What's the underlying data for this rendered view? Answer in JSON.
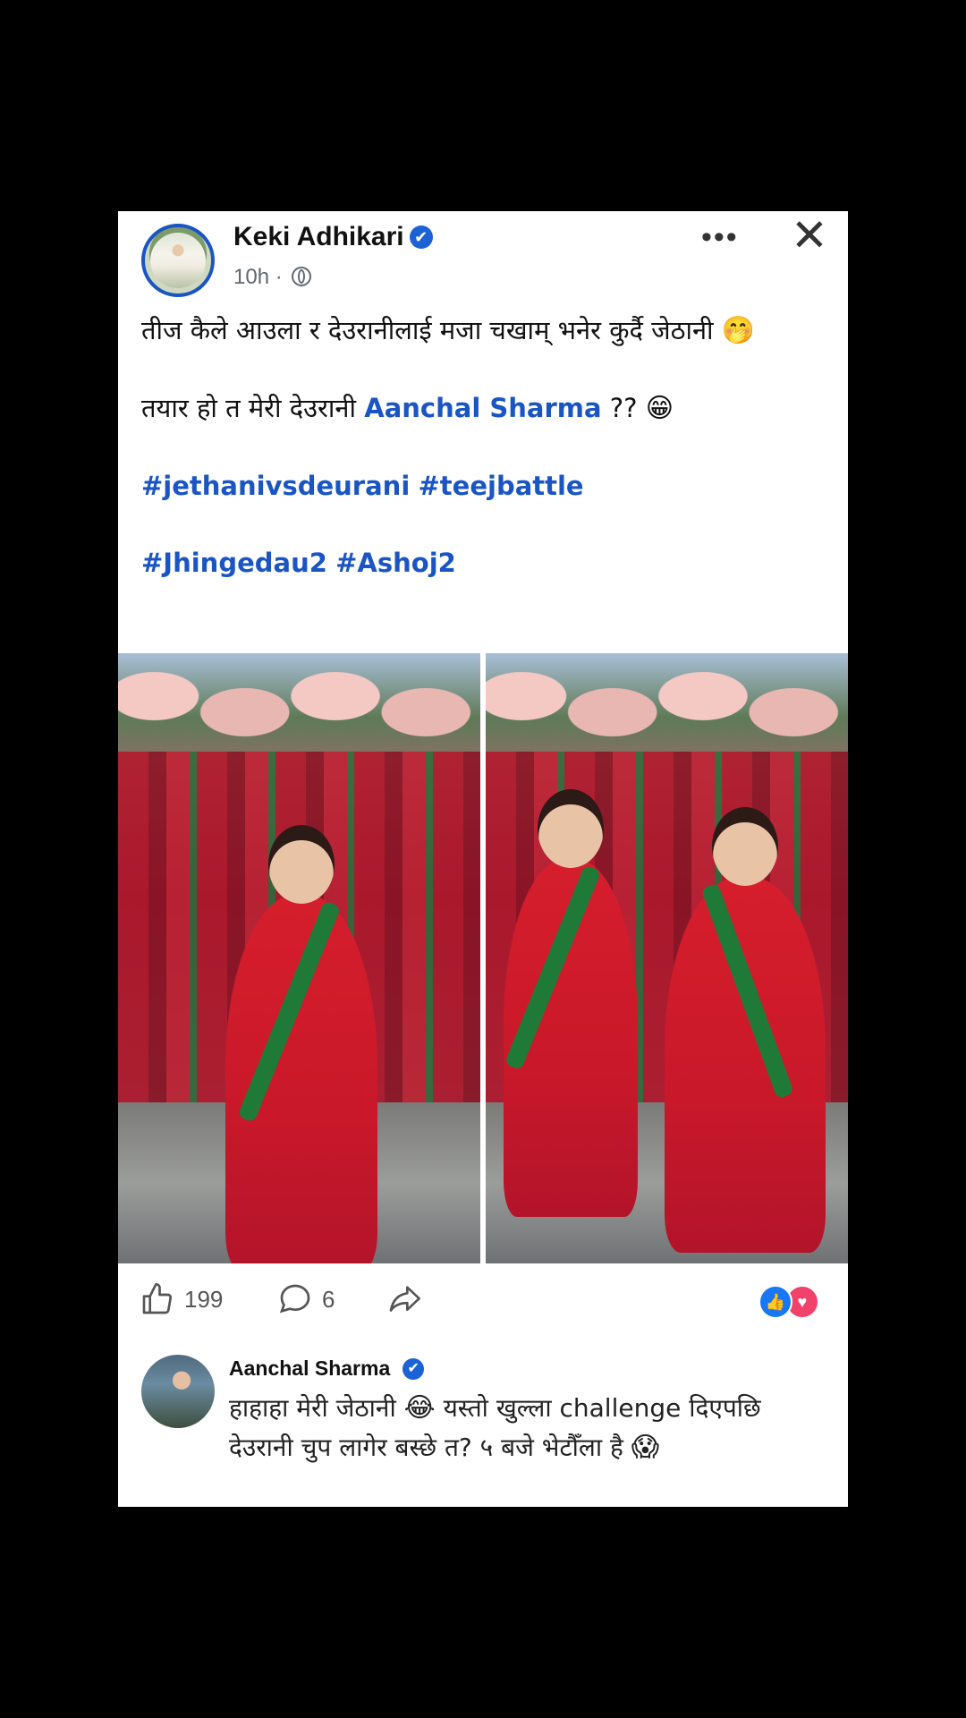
{
  "post": {
    "author": "Keki Adhikari",
    "verified_icon": "✔",
    "time": "10h",
    "visibility_icon": "globe-icon",
    "more_label": "•••",
    "close_label": "✕",
    "line1": "तीज कैले आउला र देउरानीलाई मजा चखाम् भनेर कुर्दै जेठानी",
    "emoji1": "🤭",
    "line2_prefix": "तयार हो त मेरी देउरानी ",
    "mention": "Aanchal Sharma",
    "line2_suffix": " ?? ",
    "emoji2": "😁",
    "hashtag1": "#jethanivsdeurani",
    "hashtag2": "#teejbattle",
    "hashtag3": "#Jhingedau2",
    "hashtag4": "#Ashoj2"
  },
  "actions": {
    "like_count": "199",
    "comment_count": "6",
    "like_icon": "thumbs-up-icon",
    "comment_icon": "speech-bubble-icon",
    "share_icon": "share-arrow-icon",
    "reaction_like": "👍",
    "reaction_love": "♥"
  },
  "comment": {
    "author": "Aanchal Sharma",
    "verified_icon": "✔",
    "text_a": "हाहाहा मेरी जेठानी ",
    "emoji_a": "😂",
    "text_b": " यस्तो खुल्ला challenge दिएपछि देउरानी चुप लागेर बस्छे त? ५ बजे भेटौँला है ",
    "emoji_b": "😱"
  },
  "colors": {
    "link": "#1b55c4",
    "verified": "#1b62d6",
    "like_reaction": "#1877f2",
    "love_reaction": "#f0426a"
  }
}
